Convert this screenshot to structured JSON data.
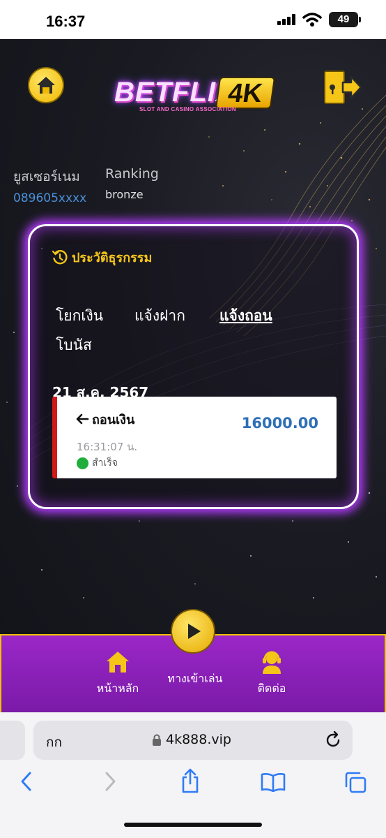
{
  "status_bar": {
    "time": "16:37",
    "battery": "49"
  },
  "header": {
    "logo_main": "BETFLIX",
    "logo_badge": "4K",
    "logo_tagline": "SLOT AND CASINO ASSOCIATION"
  },
  "user": {
    "username_label": "ยูสเซอร์เนม",
    "username_value": "089605xxxx",
    "ranking_label": "Ranking",
    "ranking_value": "bronze"
  },
  "history": {
    "title": "ประวัติธุรกรรม",
    "tabs": [
      {
        "label": "โยกเงิน",
        "active": false
      },
      {
        "label": "แจ้งฝาก",
        "active": false
      },
      {
        "label": "แจ้งถอน",
        "active": true
      },
      {
        "label": "โบนัส",
        "active": false
      }
    ],
    "date": "21 ส.ค. 2567",
    "transactions": [
      {
        "type": "ถอนเงิน",
        "amount": "16000.00",
        "time": "16:31:07 น.",
        "status": "สำเร็จ"
      }
    ]
  },
  "bottom_nav": {
    "home_label": "หน้าหลัก",
    "play_label": "ทางเข้าเล่น",
    "contact_label": "ติดต่อ"
  },
  "browser": {
    "aa_label": "กก",
    "url": "4k888.vip"
  },
  "colors": {
    "accent_gold": "#f5c518",
    "neon_purple": "#b43cff",
    "nav_purple": "#9b27c8",
    "amount_blue": "#2e6fb7",
    "withdraw_red": "#d21919",
    "success_green": "#1fae3c"
  }
}
